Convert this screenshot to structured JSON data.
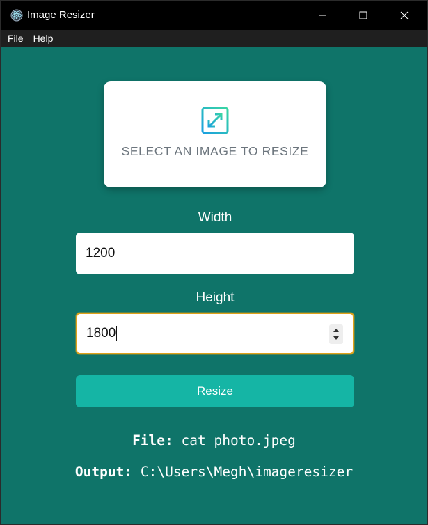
{
  "window": {
    "title": "Image Resizer",
    "icon": "app-icon"
  },
  "menu": {
    "items": [
      {
        "label": "File"
      },
      {
        "label": "Help"
      }
    ]
  },
  "dropzone": {
    "icon": "expand-icon",
    "label": "SELECT AN IMAGE TO RESIZE"
  },
  "form": {
    "width_label": "Width",
    "width_value": "1200",
    "height_label": "Height",
    "height_value": "1800",
    "resize_label": "Resize"
  },
  "info": {
    "file_label": "File:",
    "file_value": "cat photo.jpeg",
    "output_label": "Output:",
    "output_value": "C:\\Users\\Megh\\imageresizer"
  },
  "colors": {
    "background": "#0f7469",
    "accent": "#15b5a5",
    "focus_border": "#e0a21a"
  }
}
